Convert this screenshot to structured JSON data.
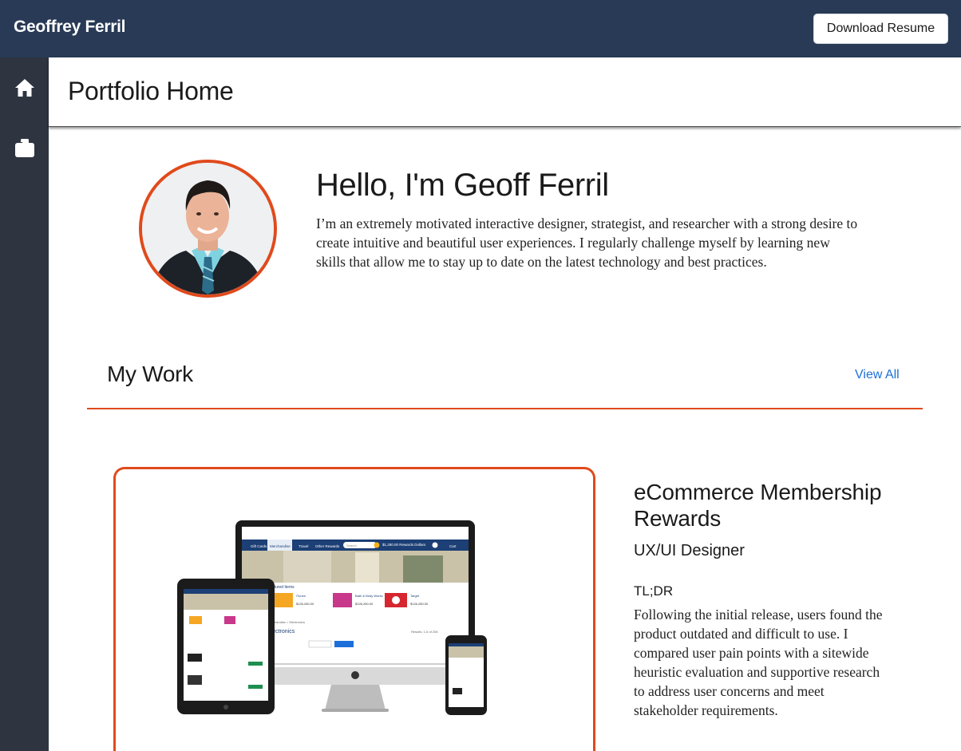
{
  "header": {
    "brand": "Geoffrey Ferril",
    "resume_button": "Download Resume",
    "color": "#283a55"
  },
  "sidebar": {
    "items": [
      {
        "icon": "home-icon"
      },
      {
        "icon": "briefcase-icon"
      }
    ]
  },
  "page": {
    "title": "Portfolio Home"
  },
  "profile": {
    "greeting": "Hello, I'm Geoff Ferril",
    "bio": "I’m an extremely motivated interactive designer, strategist, and researcher with a strong desire to create intuitive and beautiful user experiences. I regularly challenge myself by learning new skills that allow me to stay up to date on the latest technology and best practices.",
    "accent": "#e04a1c"
  },
  "work": {
    "section_title": "My Work",
    "view_all": "View All",
    "project": {
      "title": "eCommerce Membership Rewards",
      "role": "UX/UI Designer",
      "tldr_heading": "TL;DR",
      "description": "Following the initial release, users found the product outdated and difficult to use. I compared user pain points with a sitewide heuristic evaluation and supportive research to address user concerns and meet stakeholder requirements.",
      "mockup": {
        "nav_tabs": [
          "Gift Cards",
          "Merchandise",
          "Travel",
          "Other Rewards"
        ],
        "balance": "$1,280.00 Rewards Dollars",
        "cart": "Cart",
        "search": "Search",
        "featured_heading": "Featured Items",
        "featured": [
          {
            "name": "iTunes",
            "price": "$126,280.00",
            "unit": "Rewards Dollars"
          },
          {
            "name": "Bath & Body Works",
            "price": "$126,280.00",
            "unit": "Rewards Dollars"
          },
          {
            "name": "Target",
            "price": "$126,280.00",
            "unit": "Rewards Dollars"
          }
        ],
        "breadcrumb": "Merchandise  >  Electronics",
        "category": "Electronics",
        "results": "Results: 1-6 of 206"
      }
    }
  }
}
